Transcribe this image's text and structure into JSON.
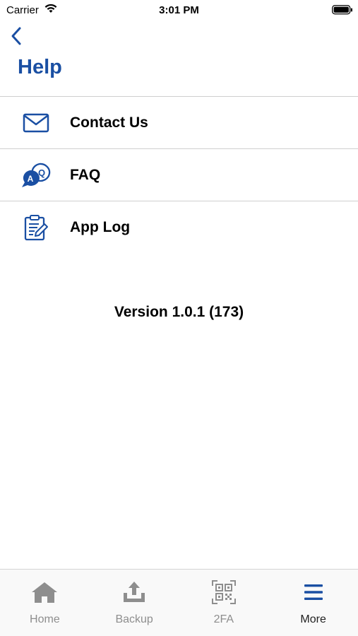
{
  "status_bar": {
    "carrier": "Carrier",
    "time": "3:01 PM"
  },
  "header": {
    "back_icon": "chevron-left-icon",
    "title": "Help"
  },
  "menu": {
    "items": [
      {
        "label": "Contact Us",
        "icon": "envelope-icon"
      },
      {
        "label": "FAQ",
        "icon": "faq-chat-icon"
      },
      {
        "label": "App Log",
        "icon": "clipboard-edit-icon"
      }
    ]
  },
  "version_text": "Version 1.0.1 (173)",
  "tab_bar": {
    "tabs": [
      {
        "label": "Home",
        "icon": "home-icon",
        "active": false
      },
      {
        "label": "Backup",
        "icon": "upload-icon",
        "active": false
      },
      {
        "label": "2FA",
        "icon": "qr-code-icon",
        "active": false
      },
      {
        "label": "More",
        "icon": "hamburger-menu-icon",
        "active": true
      }
    ]
  },
  "colors": {
    "accent": "#1a4fa3",
    "inactive_tab": "#8e8e8e",
    "divider": "#cfcfcf"
  }
}
